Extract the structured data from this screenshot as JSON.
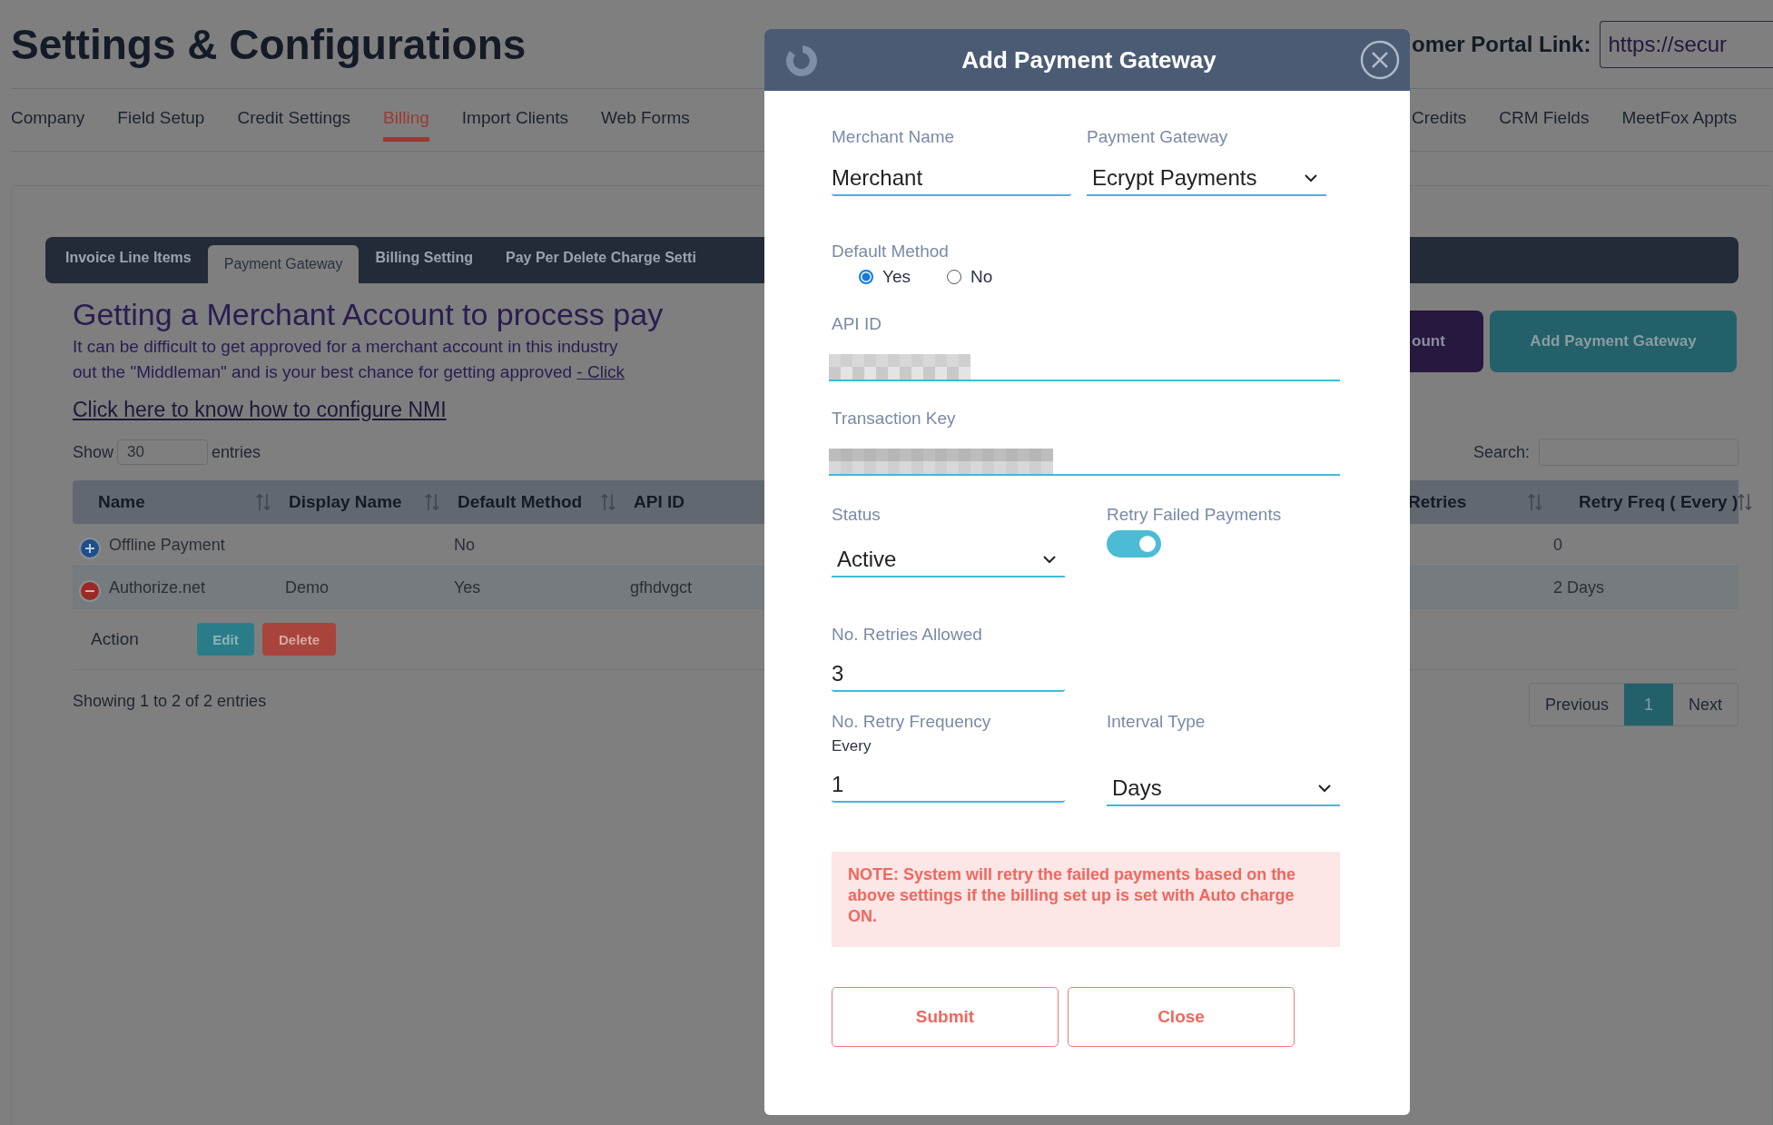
{
  "page_title": "Settings & Configurations",
  "portal_link": {
    "label": "omer Portal Link:",
    "value": "https://secur"
  },
  "nav": {
    "tabs_left_of_dialog": [
      {
        "label": "Company",
        "selected": false
      },
      {
        "label": "Field Setup",
        "selected": false
      },
      {
        "label": "Credit Settings",
        "selected": false
      },
      {
        "label": "Billing",
        "selected": true
      },
      {
        "label": "Import Clients",
        "selected": false
      },
      {
        "label": "Web Forms",
        "selected": false
      }
    ],
    "tabs_right_of_dialog": [
      {
        "label": "Credits",
        "selected": false
      },
      {
        "label": "CRM Fields",
        "selected": false
      },
      {
        "label": "MeetFox Appts",
        "selected": false
      }
    ]
  },
  "sub_tabs": [
    {
      "label": "Invoice Line Items",
      "selected": false
    },
    {
      "label": "Payment Gateway",
      "selected": true
    },
    {
      "label": "Billing Setting",
      "selected": false
    },
    {
      "label": "Pay Per Delete Charge Setti",
      "selected": false
    }
  ],
  "merchant_info": {
    "heading": "Getting a Merchant Account to process pay",
    "lines": [
      {
        "text": "It can be difficult to get approved for a merchant account in this industry"
      },
      {
        "text": "out the \"Middleman\" and is your best chance for getting approved ",
        "link": "- Click"
      }
    ],
    "nmi_link": "Click here to know how to configure NMI"
  },
  "action_buttons": [
    {
      "label": "ount",
      "kind": "account"
    },
    {
      "label": "Add Payment Gateway",
      "kind": "add"
    }
  ],
  "table_controls": {
    "show_label": "Show",
    "page_size": "30",
    "entries_label": "entries",
    "search_label": "Search:"
  },
  "table": {
    "columns_left_of_dialog": [
      {
        "label": "Name",
        "sortable": true
      },
      {
        "label": "Display Name",
        "sortable": true
      },
      {
        "label": "Default Method",
        "sortable": true
      },
      {
        "label": "API ID",
        "sortable": false
      }
    ],
    "columns_right_of_dialog": [
      {
        "label": "Retries",
        "sortable": true
      },
      {
        "label": "Retry Freq ( Every )",
        "sortable": true
      }
    ],
    "rows": [
      {
        "expanded": false,
        "name": "Offline Payment",
        "default_method": "No",
        "retry_freq": "0"
      },
      {
        "expanded": true,
        "name": "Authorize.net",
        "display_name": "Demo",
        "default_method": "Yes",
        "api_id": "gfhdvgct",
        "retry_freq": "2 Days",
        "action_label": "Action",
        "actions": [
          {
            "label": "Edit",
            "kind": "edit"
          },
          {
            "label": "Delete",
            "kind": "delete"
          }
        ]
      }
    ],
    "info": "Showing 1 to 2 of 2 entries",
    "pagination": {
      "previous": "Previous",
      "pages": [
        {
          "label": "1",
          "selected": true
        }
      ],
      "next": "Next"
    }
  },
  "dialog": {
    "title": "Add Payment Gateway",
    "merchant_name": {
      "label": "Merchant Name",
      "value": "Merchant"
    },
    "payment_gateway": {
      "label": "Payment Gateway",
      "value": "Ecrypt Payments"
    },
    "default_method": {
      "label": "Default Method",
      "options": [
        {
          "label": "Yes",
          "selected": true
        },
        {
          "label": "No",
          "selected": false
        }
      ]
    },
    "api_id": {
      "label": "API ID"
    },
    "transaction_key": {
      "label": "Transaction Key"
    },
    "status": {
      "label": "Status",
      "value": "Active"
    },
    "retry_failed_payments": {
      "label": "Retry Failed Payments",
      "on": true
    },
    "retries_allowed": {
      "label": "No. Retries Allowed",
      "value": "3"
    },
    "retry_frequency": {
      "label": "No. Retry Frequency",
      "prefix": "Every",
      "value": "1"
    },
    "interval_type": {
      "label": "Interval Type",
      "value": "Days"
    },
    "note": "NOTE: System will retry the failed payments based on the above settings if the billing set up is set with Auto charge ON.",
    "buttons": [
      "Submit",
      "Close"
    ]
  }
}
